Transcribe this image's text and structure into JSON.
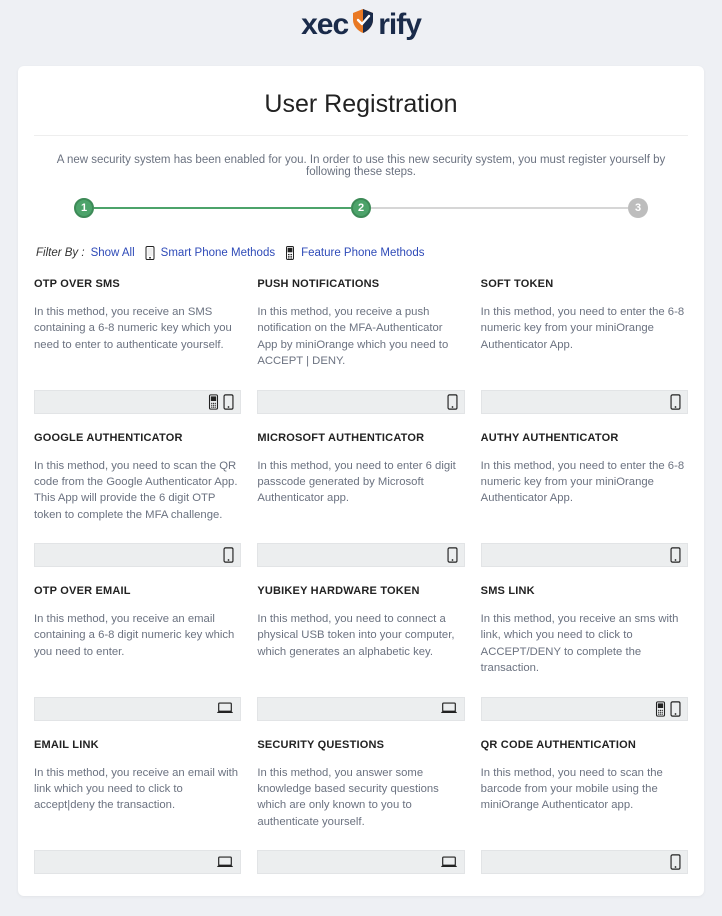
{
  "logo": {
    "text_left": "xec",
    "text_right": "rify"
  },
  "title": "User Registration",
  "instructions": "A new security system has been enabled for you. In order to use this new security system, you must register yourself by following these steps.",
  "steps": {
    "s1": "1",
    "s2": "2",
    "s3": "3"
  },
  "filter": {
    "label": "Filter By :",
    "show_all": "Show All",
    "smart": "Smart Phone Methods",
    "feature": "Feature Phone Methods"
  },
  "methods": {
    "m0": {
      "title": "OTP OVER SMS",
      "desc": "In this method, you receive an SMS containing a 6-8 numeric key which you need to enter to authenticate yourself."
    },
    "m1": {
      "title": "PUSH NOTIFICATIONS",
      "desc": "In this method, you receive a push notification on the MFA-Authenticator App by miniOrange which you need to ACCEPT | DENY."
    },
    "m2": {
      "title": "SOFT TOKEN",
      "desc": "In this method, you need to enter the 6-8 numeric key from your miniOrange Authenticator App."
    },
    "m3": {
      "title": "GOOGLE AUTHENTICATOR",
      "desc": "In this method, you need to scan the QR code from the Google Authenticator App. This App will provide the 6 digit OTP token to complete the MFA challenge."
    },
    "m4": {
      "title": "MICROSOFT AUTHENTICATOR",
      "desc": "In this method, you need to enter 6 digit passcode generated by Microsoft Authenticator app."
    },
    "m5": {
      "title": "AUTHY AUTHENTICATOR",
      "desc": "In this method, you need to enter the 6-8 numeric key from your miniOrange Authenticator App."
    },
    "m6": {
      "title": "OTP OVER EMAIL",
      "desc": "In this method, you receive an email containing a 6-8 digit numeric key which you need to enter."
    },
    "m7": {
      "title": "YUBIKEY HARDWARE TOKEN",
      "desc": "In this method, you need to connect a physical USB token into your computer, which generates an alphabetic key."
    },
    "m8": {
      "title": "SMS LINK",
      "desc": "In this method, you receive an sms with link, which you need to click to ACCEPT/DENY to complete the transaction."
    },
    "m9": {
      "title": "EMAIL LINK",
      "desc": "In this method, you receive an email with link which you need to click to accept|deny the transaction."
    },
    "m10": {
      "title": "SECURITY QUESTIONS",
      "desc": "In this method, you answer some knowledge based security questions which are only known to you to authenticate yourself."
    },
    "m11": {
      "title": "QR CODE AUTHENTICATION",
      "desc": "In this method, you need to scan the barcode from your mobile using the miniOrange Authenticator app."
    }
  }
}
